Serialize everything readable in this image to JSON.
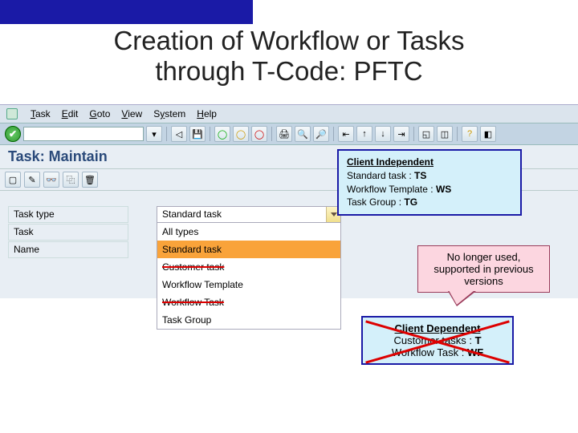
{
  "slide": {
    "title_line1": "Creation of Workflow or Tasks",
    "title_line2": "through T-Code: PFTC"
  },
  "menu": {
    "task": "Task",
    "edit": "Edit",
    "goto": "Goto",
    "view": "View",
    "system": "System",
    "help": "Help"
  },
  "screen": {
    "title": "Task: Maintain"
  },
  "form": {
    "task_type_label": "Task type",
    "task_label": "Task",
    "name_label": "Name",
    "selected": "Standard task",
    "options": {
      "all": "All types",
      "standard": "Standard task",
      "customer": "Customer task",
      "wft": "Workflow Template",
      "wftask": "Workflow Task",
      "tg": "Task Group"
    }
  },
  "callout_ci": {
    "heading": "Client Independent",
    "l1a": "Standard task : ",
    "l1b": "TS",
    "l2a": "Workflow Template : ",
    "l2b": "WS",
    "l3a": "Task Group : ",
    "l3b": "TG"
  },
  "callout_pink": {
    "text": "No longer used, supported in previous versions"
  },
  "callout_cd": {
    "heading": "Client Dependent",
    "l1a": "Customer tasks : ",
    "l1b": "T",
    "l2a": "Workflow Task : ",
    "l2b": "WF"
  }
}
